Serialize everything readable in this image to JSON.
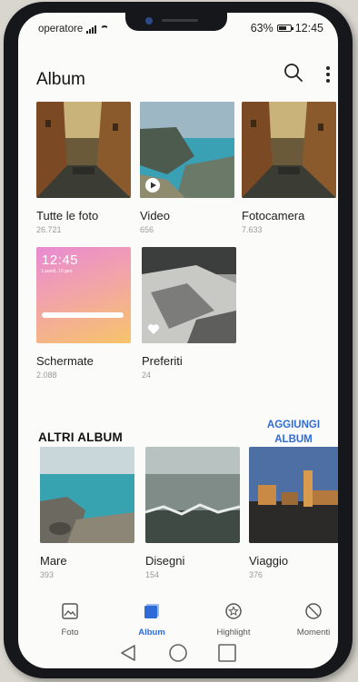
{
  "status": {
    "carrier": "operatore",
    "battery": "63%",
    "time": "12:45"
  },
  "header": {
    "title": "Album",
    "search_icon": "search-icon",
    "more_icon": "more-vertical-icon"
  },
  "albums": [
    {
      "name": "Tutte le foto",
      "count": "26.721"
    },
    {
      "name": "Video",
      "count": "656"
    },
    {
      "name": "Fotocamera",
      "count": "7.633"
    },
    {
      "name": "Schermate",
      "count": "2.088"
    },
    {
      "name": "Preferiti",
      "count": "24"
    }
  ],
  "screenshot_thumb": {
    "clock": "12:45",
    "date": "Lunedì, 10 gen"
  },
  "other_albums": {
    "title": "ALTRI ALBUM",
    "add_label_line1": "AGGIUNGI",
    "add_label_line2": "ALBUM",
    "items": [
      {
        "name": "Mare",
        "count": "393"
      },
      {
        "name": "Disegni",
        "count": "154"
      },
      {
        "name": "Viaggio",
        "count": "376"
      }
    ]
  },
  "tabs": [
    {
      "label": "Foto",
      "icon": "photo-icon"
    },
    {
      "label": "Album",
      "icon": "album-icon"
    },
    {
      "label": "Highlight",
      "icon": "highlight-icon"
    },
    {
      "label": "Momenti",
      "icon": "moments-icon"
    }
  ],
  "colors": {
    "accent": "#2f6bd6",
    "background": "#fbfbfa"
  }
}
